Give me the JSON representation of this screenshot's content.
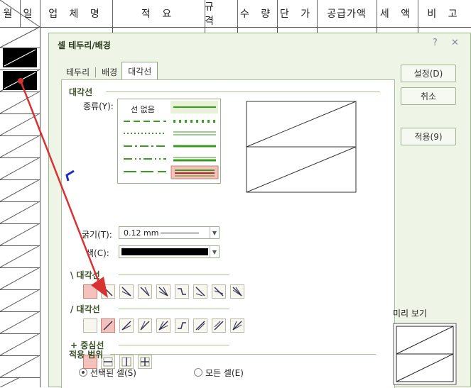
{
  "sheet": {
    "headers": [
      "월",
      "일",
      "업 체 명",
      "적          요",
      "규 격",
      "수 량",
      "단 가",
      "공급가액",
      "세 액",
      "비 고"
    ]
  },
  "dialog": {
    "title": "셀 테두리/배경",
    "help_glyph": "?",
    "close_glyph": "✕",
    "tabs": [
      "테두리",
      "배경",
      "대각선"
    ],
    "group_diagonal": "대각선",
    "type_label": "종류(Y):",
    "no_line": "선 없음",
    "thickness_label": "굵기(T):",
    "thickness_value": "0.12 mm",
    "color_label": "색(C):",
    "color_value": "#000000",
    "backslash_group": "\\ 대각선",
    "slash_group": "/ 대각선",
    "center_group": "+ 중심선",
    "apply_scope": "적용 범위",
    "radio_selected": "선택된 셀(S)",
    "radio_all": "모든 셀(E)",
    "preview_label": "미리 보기",
    "buttons": {
      "ok": "설정(D)",
      "cancel": "취소",
      "apply": "적용(9)"
    }
  },
  "colors": {
    "dialog_bg": "#eef5e6",
    "selected_btn": "#f4c2bb",
    "arrow": "#d83232",
    "line_green": "#3a9a22"
  }
}
